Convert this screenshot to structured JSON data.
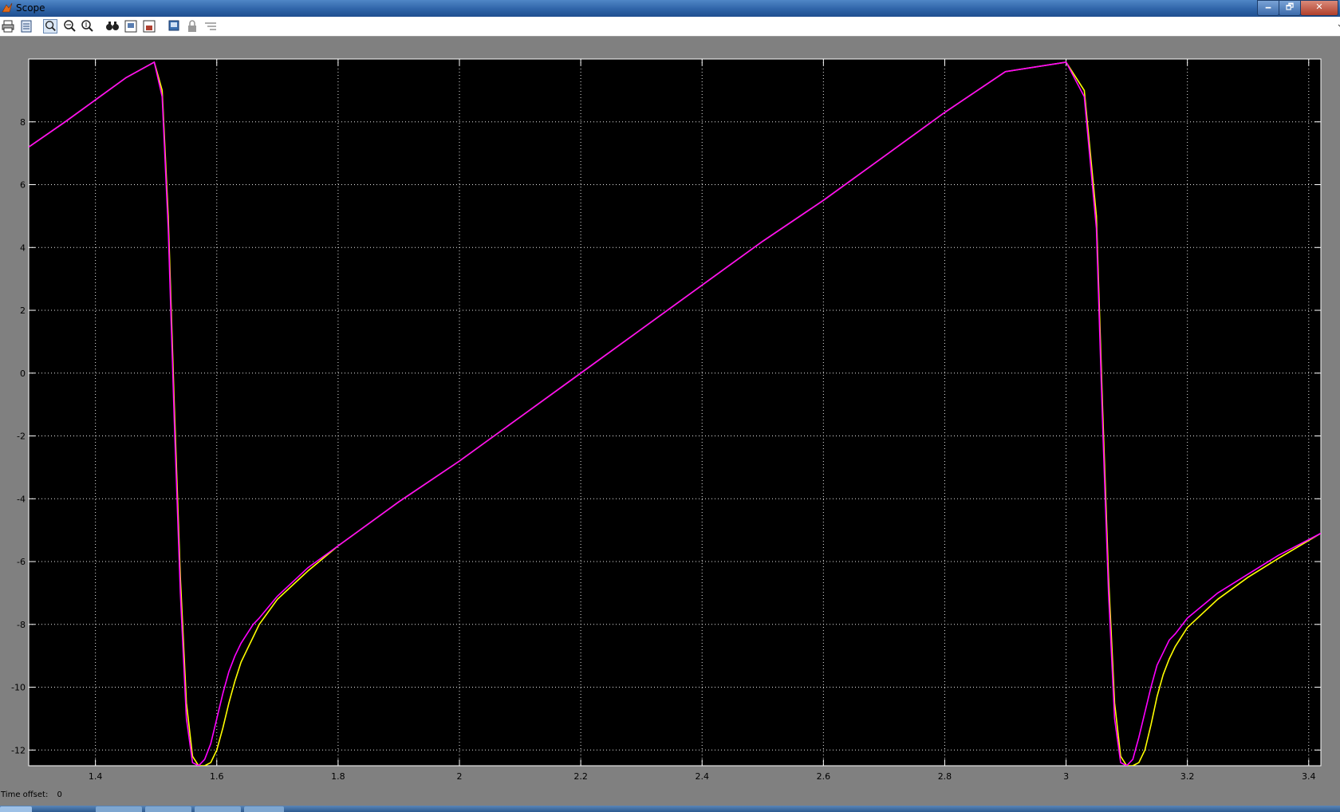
{
  "window": {
    "title": "Scope",
    "minimize_glyph": "🗕",
    "restore_glyph": "🗗",
    "close_glyph": "✕"
  },
  "toolbar": {
    "buttons": [
      {
        "name": "print-icon"
      },
      {
        "name": "parameters-icon"
      },
      {
        "name": "zoom-icon"
      },
      {
        "name": "zoom-x-icon"
      },
      {
        "name": "zoom-y-icon"
      },
      {
        "name": "autoscale-icon"
      },
      {
        "name": "save-axes-icon"
      },
      {
        "name": "restore-axes-icon"
      },
      {
        "name": "floating-scope-icon"
      },
      {
        "name": "lock-axes-icon"
      },
      {
        "name": "signal-selector-icon"
      }
    ],
    "dock_glyph": "↘"
  },
  "status": {
    "time_offset_label": "Time offset:",
    "time_offset_value": "0"
  },
  "colors": {
    "plot_bg": "#000000",
    "grid": "#ffffff",
    "series_yellow": "#ffff00",
    "series_magenta": "#ff00ff"
  },
  "chart_data": {
    "type": "line",
    "title": "",
    "xlabel": "",
    "ylabel": "",
    "xlim": [
      1.29,
      3.42
    ],
    "ylim": [
      -12.5,
      10.0
    ],
    "xticks": [
      1.4,
      1.6,
      1.8,
      2,
      2.2,
      2.4,
      2.6,
      2.8,
      3,
      3.2,
      3.4
    ],
    "xtick_labels": [
      "1.4",
      "1.6",
      "1.8",
      "2",
      "2.2",
      "2.4",
      "2.6",
      "2.8",
      "3",
      "3.2",
      "3.4"
    ],
    "yticks": [
      8,
      6,
      4,
      2,
      0,
      -2,
      -4,
      -6,
      -8,
      -10,
      -12
    ],
    "ytick_labels": [
      "8",
      "6",
      "4",
      "2",
      "0",
      "-2",
      "-4",
      "-6",
      "-8",
      "-10",
      "-12"
    ],
    "grid": true,
    "series": [
      {
        "color": "#ffff00",
        "x": [
          1.29,
          1.35,
          1.4,
          1.45,
          1.497,
          1.51,
          1.52,
          1.53,
          1.54,
          1.55,
          1.56,
          1.57,
          1.58,
          1.59,
          1.6,
          1.61,
          1.62,
          1.63,
          1.64,
          1.65,
          1.66,
          1.67,
          1.7,
          1.75,
          1.8,
          1.9,
          2.0,
          2.1,
          2.2,
          2.3,
          2.4,
          2.5,
          2.6,
          2.7,
          2.8,
          2.9,
          3.0,
          3.03,
          3.05,
          3.06,
          3.07,
          3.08,
          3.09,
          3.1,
          3.11,
          3.12,
          3.13,
          3.14,
          3.15,
          3.16,
          3.17,
          3.18,
          3.2,
          3.25,
          3.3,
          3.35,
          3.42
        ],
        "y": [
          7.2,
          8.0,
          8.7,
          9.4,
          9.9,
          9.0,
          5.0,
          -1.0,
          -6.5,
          -10.5,
          -12.2,
          -12.5,
          -12.5,
          -12.4,
          -12.0,
          -11.3,
          -10.5,
          -9.8,
          -9.2,
          -8.8,
          -8.4,
          -8.0,
          -7.2,
          -6.3,
          -5.5,
          -4.1,
          -2.8,
          -1.4,
          0.0,
          1.4,
          2.8,
          4.2,
          5.5,
          6.9,
          8.3,
          9.6,
          9.9,
          9.0,
          5.0,
          -1.0,
          -6.5,
          -10.5,
          -12.2,
          -12.5,
          -12.5,
          -12.4,
          -12.0,
          -11.2,
          -10.3,
          -9.6,
          -9.1,
          -8.7,
          -8.1,
          -7.2,
          -6.5,
          -5.9,
          -5.1
        ]
      },
      {
        "color": "#ff00ff",
        "x": [
          1.29,
          1.35,
          1.4,
          1.45,
          1.497,
          1.51,
          1.52,
          1.53,
          1.54,
          1.55,
          1.56,
          1.57,
          1.58,
          1.59,
          1.6,
          1.61,
          1.62,
          1.63,
          1.64,
          1.65,
          1.66,
          1.67,
          1.7,
          1.75,
          1.8,
          1.9,
          2.0,
          2.1,
          2.2,
          2.3,
          2.4,
          2.5,
          2.6,
          2.7,
          2.8,
          2.9,
          3.0,
          3.03,
          3.05,
          3.06,
          3.07,
          3.08,
          3.09,
          3.1,
          3.11,
          3.12,
          3.13,
          3.14,
          3.15,
          3.16,
          3.17,
          3.18,
          3.2,
          3.25,
          3.3,
          3.35,
          3.42
        ],
        "y": [
          7.2,
          8.0,
          8.7,
          9.4,
          9.9,
          8.8,
          4.6,
          -1.5,
          -7.0,
          -11.0,
          -12.4,
          -12.5,
          -12.3,
          -11.8,
          -11.0,
          -10.2,
          -9.5,
          -9.0,
          -8.6,
          -8.3,
          -8.0,
          -7.8,
          -7.1,
          -6.2,
          -5.5,
          -4.1,
          -2.8,
          -1.4,
          0.0,
          1.4,
          2.8,
          4.2,
          5.5,
          6.9,
          8.3,
          9.6,
          9.9,
          8.8,
          4.6,
          -1.5,
          -7.0,
          -11.0,
          -12.4,
          -12.5,
          -12.3,
          -11.6,
          -10.8,
          -10.0,
          -9.3,
          -8.9,
          -8.5,
          -8.3,
          -7.8,
          -7.0,
          -6.4,
          -5.8,
          -5.1
        ]
      }
    ]
  }
}
